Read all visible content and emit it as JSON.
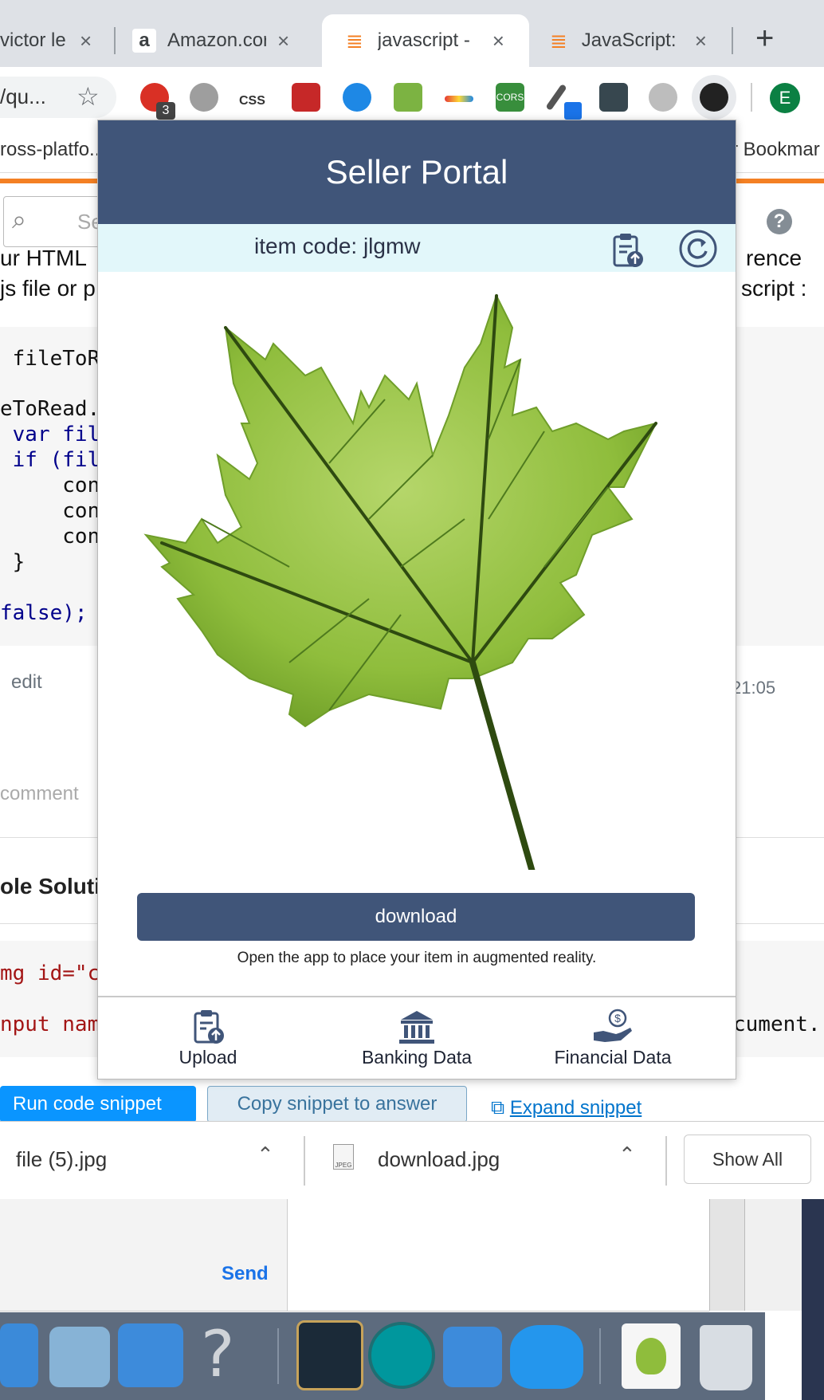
{
  "browser": {
    "tabs": [
      {
        "title": "victor le",
        "close": "×"
      },
      {
        "title": "Amazon.cor",
        "close": "×"
      },
      {
        "title": "javascript -",
        "close": "×"
      },
      {
        "title": "JavaScript:",
        "close": "×"
      }
    ],
    "new_tab": "+",
    "omnibox_text": "/qu...",
    "ext_badge": "3",
    "ext_css_label": "CSS",
    "ext_cors_label": "CORS",
    "profile_initial": "E",
    "bookmark_left": "ross-platfo...",
    "bookmark_right": "r Bookmar"
  },
  "page": {
    "search_placeholder": "Sear",
    "help": "?",
    "text_line1_left": "ur HTML",
    "text_line1_right": "rence",
    "text_line2_left": "js file or p",
    "text_line2_right": "script :",
    "code_lines": [
      " fileToR",
      "",
      "eToRead.",
      " var fil",
      " if (fil",
      "     con",
      "     con",
      "     con",
      " }",
      "",
      "false);"
    ],
    "edit": "edit",
    "timestamp": "21:05",
    "comment": "comment",
    "section_heading": "ole Soluti",
    "code2_line1": "mg id=\"c",
    "code2_line2": "nput nam",
    "code2_right": "cument.",
    "run_button": "Run code snippet",
    "copy_button": "Copy snippet to answer",
    "expand_link": "Expand snippet"
  },
  "popup": {
    "title": "Seller Portal",
    "item_code": "item code: jlgmw",
    "download_label": "download",
    "hint": "Open the app to place your item in augmented reality.",
    "nav": [
      {
        "label": "Upload",
        "icon": "upload-document-icon"
      },
      {
        "label": "Banking Data",
        "icon": "bank-icon"
      },
      {
        "label": "Financial Data",
        "icon": "hand-dollar-icon"
      }
    ],
    "colors": {
      "header": "#405579",
      "code_bar": "#e2f7fa"
    }
  },
  "downloads": {
    "items": [
      {
        "name": "file (5).jpg"
      },
      {
        "name": "download.jpg",
        "type_label": "JPEG"
      }
    ],
    "show_all": "Show All"
  },
  "chat": {
    "send": "Send"
  }
}
